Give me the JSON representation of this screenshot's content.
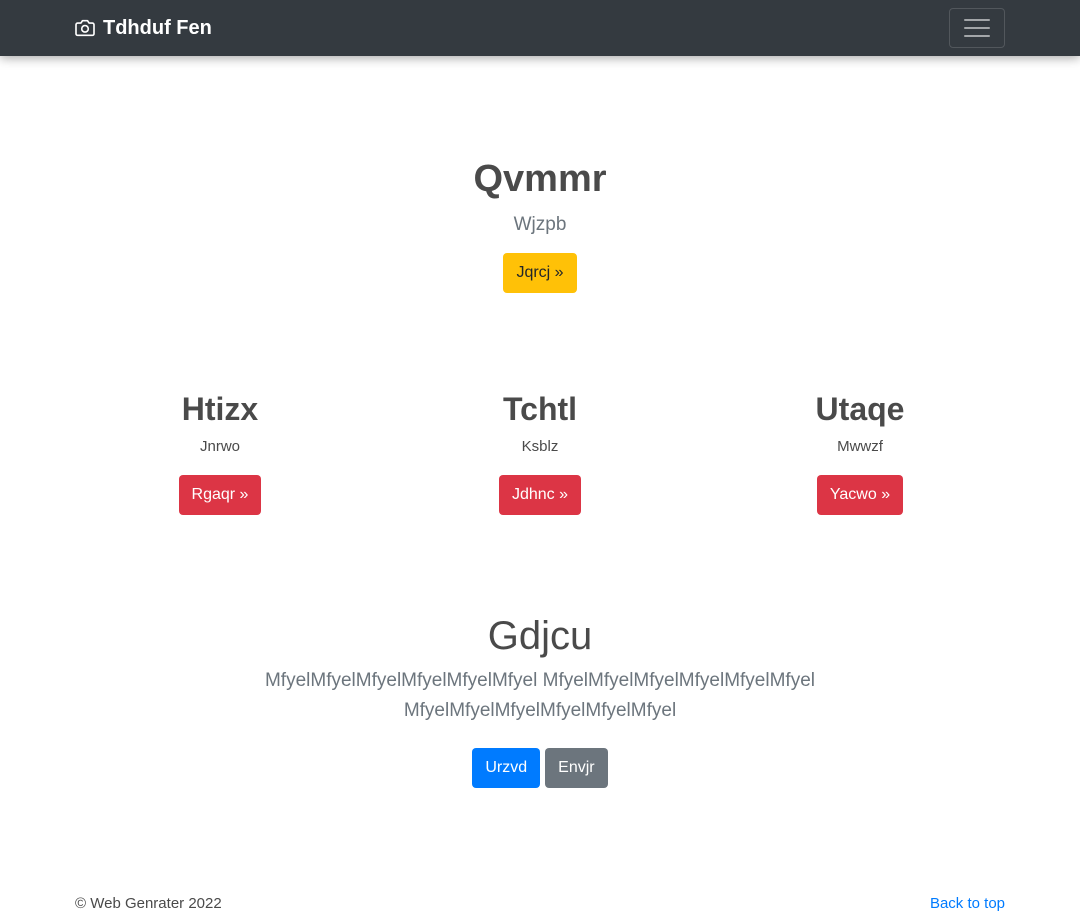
{
  "navbar": {
    "brand": "Tdhduf Fen",
    "brand_icon": "camera-icon",
    "toggler_icon": "hamburger-icon",
    "background": "#343a40"
  },
  "hero": {
    "title": "Qvmmr",
    "subtitle": "Wjzpb",
    "button": "Jqrcj »",
    "button_color": "#ffc107"
  },
  "columns": [
    {
      "title": "Htizx",
      "text": "Jnrwo",
      "button": "Rgaqr »"
    },
    {
      "title": "Tchtl",
      "text": "Ksblz",
      "button": "Jdhnc »"
    },
    {
      "title": "Utaqe",
      "text": "Mwwzf",
      "button": "Yacwo »"
    }
  ],
  "album": {
    "title": "Gdjcu",
    "lead": "MfyelMfyelMfyelMfyelMfyelMfyel MfyelMfyelMfyelMfyelMfyelMfyel MfyelMfyelMfyelMfyelMfyelMfyel",
    "primary_button": "Urzvd",
    "secondary_button": "Envjr"
  },
  "footer": {
    "copyright": "© Web Genrater 2022",
    "back_to_top": "Back to top"
  },
  "colors": {
    "danger": "#dc3545",
    "primary": "#007bff",
    "secondary": "#6c757d",
    "warning": "#ffc107"
  }
}
